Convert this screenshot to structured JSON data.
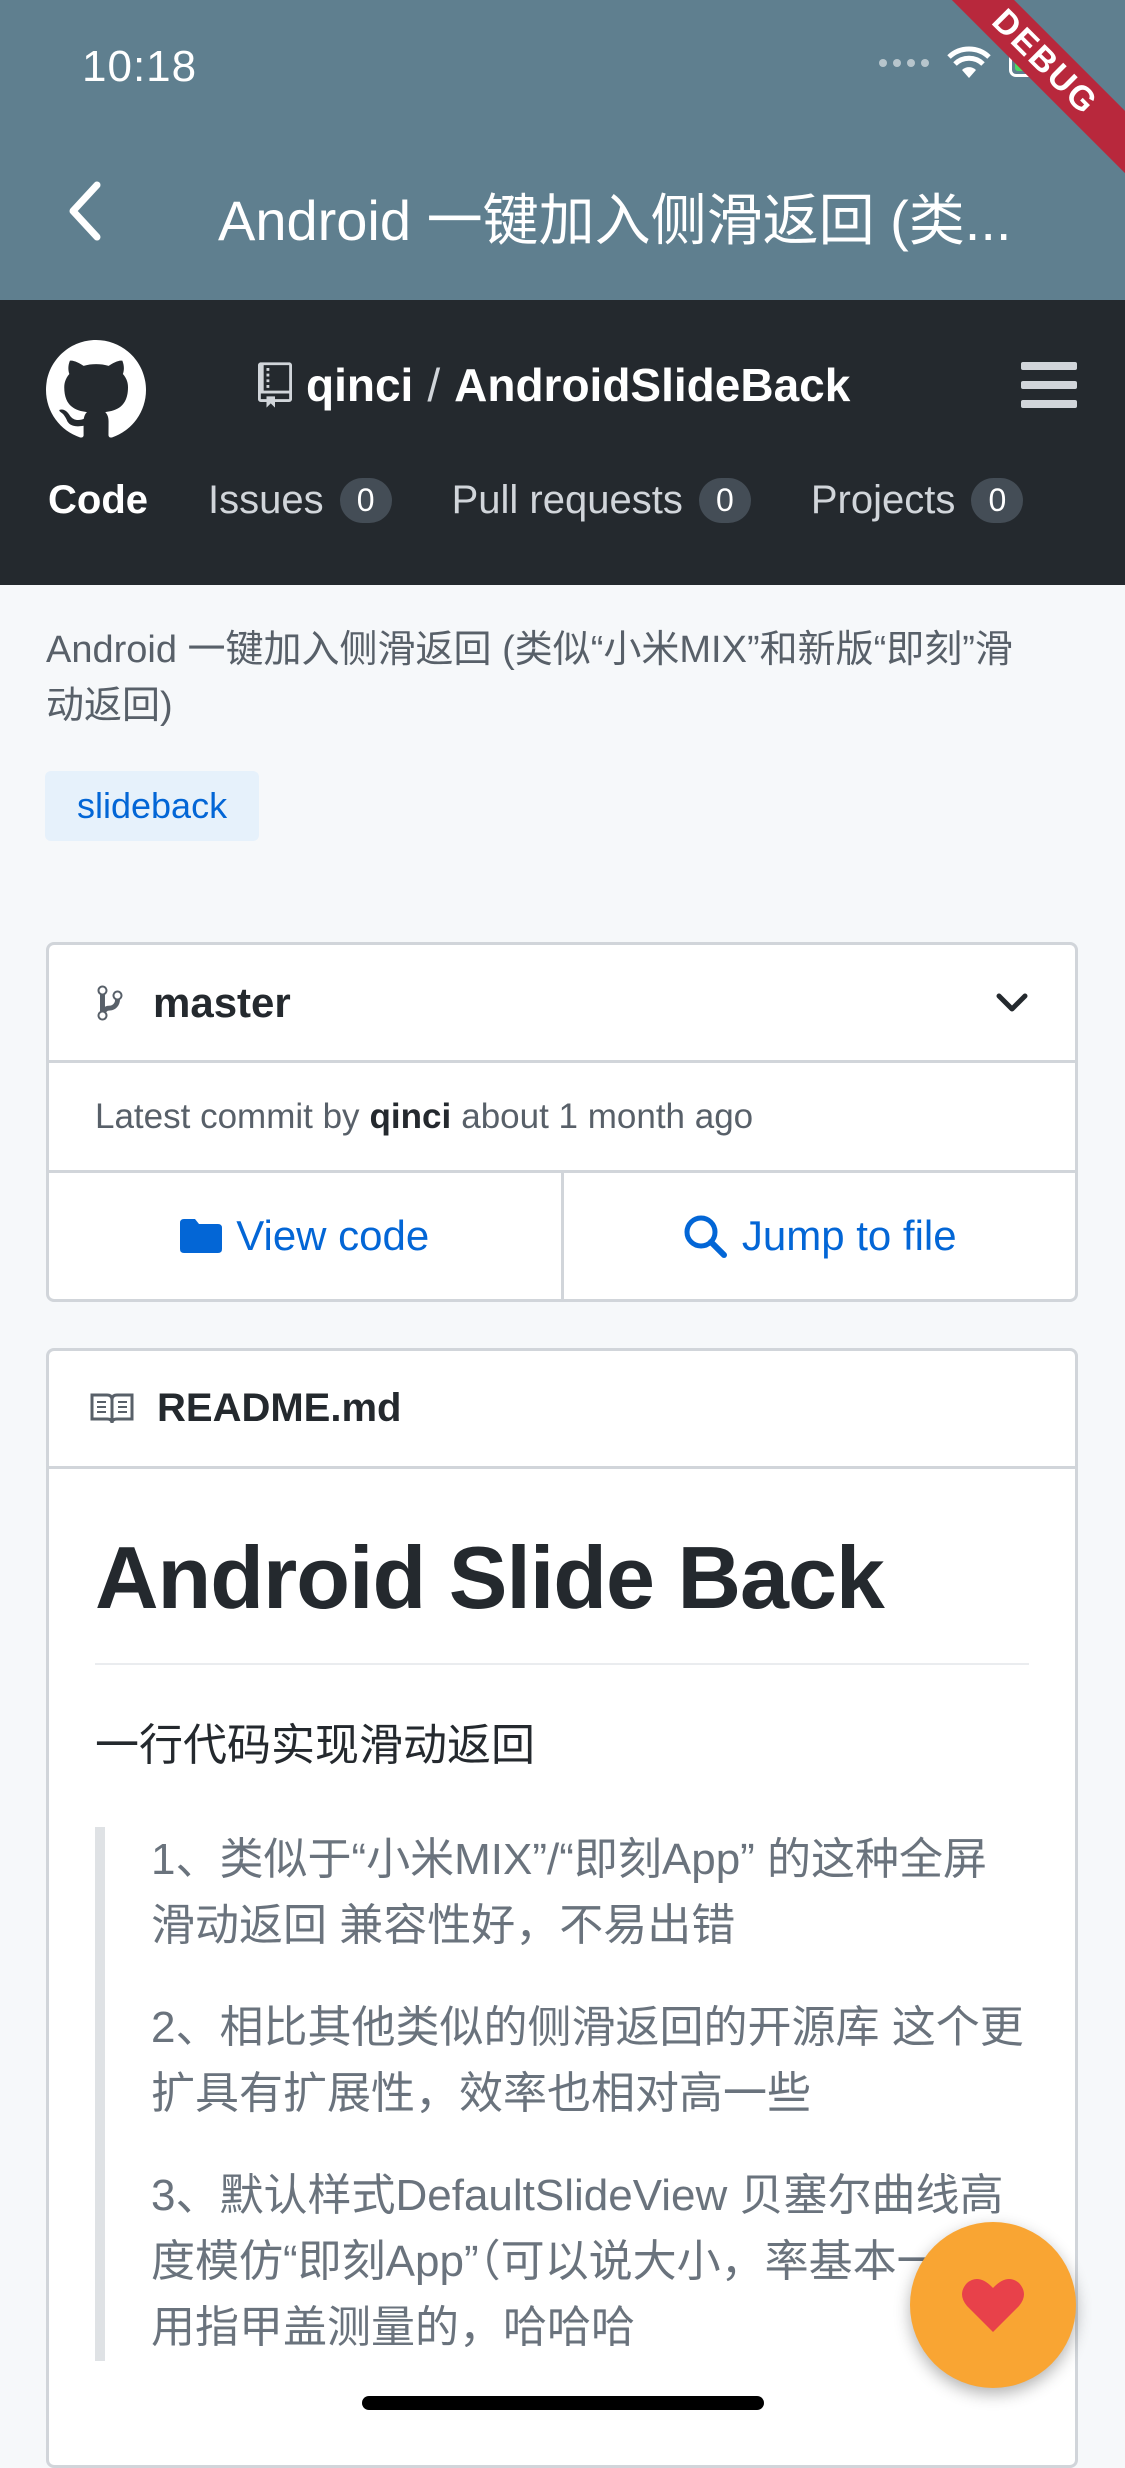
{
  "status_bar": {
    "time": "10:18",
    "debug_label": "DEBUG"
  },
  "app_bar": {
    "title": "Android 一键加入侧滑返回 (类..."
  },
  "github": {
    "owner": "qinci",
    "separator": "/",
    "repo": "AndroidSlideBack",
    "tabs": [
      {
        "label": "Code",
        "count": null
      },
      {
        "label": "Issues",
        "count": "0"
      },
      {
        "label": "Pull requests",
        "count": "0"
      },
      {
        "label": "Projects",
        "count": "0"
      }
    ]
  },
  "repo": {
    "description": "Android 一键加入侧滑返回 (类似“小米MIX”和新版“即刻”滑动返回)",
    "topic": "slideback"
  },
  "branch": {
    "name": "master",
    "commit_prefix": "Latest commit by",
    "commit_author": "qinci",
    "commit_time": "about 1 month ago",
    "view_code": "View code",
    "jump_to_file": "Jump to file"
  },
  "readme": {
    "filename": "README.md",
    "h1": "Android Slide Back",
    "intro": "一行代码实现滑动返回",
    "quote": [
      "1、类似于“小米MIX”/“即刻App” 的这种全屏滑动返回 兼容性好，不易出错",
      "2、相比其他类似的侧滑返回的开源库 这个更扩具有扩展性，效率也相对高一些",
      "3、默认样式DefaultSlideView 贝塞尔曲线高度模仿“即刻App”（可以说大小，率基本一样，用指甲盖测量的，哈哈哈"
    ]
  },
  "colors": {
    "app_bar": "#5f7f8f",
    "github_header": "#24292e",
    "link": "#0366d6",
    "fab": "#f9a533",
    "heart": "#e8414a"
  },
  "icons": [
    "back-arrow-icon",
    "github-logo-icon",
    "repo-icon",
    "menu-icon",
    "branch-icon",
    "chevron-down-icon",
    "folder-icon",
    "search-icon",
    "book-icon",
    "heart-icon"
  ]
}
